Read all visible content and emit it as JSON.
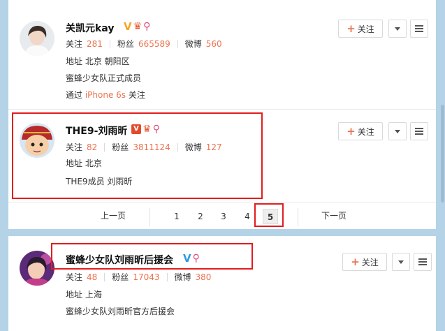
{
  "users": [
    {
      "name": "关凯元kay",
      "follow_label": "关注",
      "follow_count": "281",
      "fans_label": "粉丝",
      "fans_count": "665589",
      "weibo_label": "微博",
      "weibo_count": "560",
      "address_label": "地址",
      "address": "北京 朝阳区",
      "bio": "蜜蜂少女队正式成员",
      "via_prefix": "通过",
      "via_device": "iPhone 6s",
      "via_suffix": "关注",
      "button_label": "关注",
      "badge": "V"
    },
    {
      "name": "THE9-刘雨昕",
      "follow_label": "关注",
      "follow_count": "82",
      "fans_label": "粉丝",
      "fans_count": "3811124",
      "weibo_label": "微博",
      "weibo_count": "127",
      "address_label": "地址",
      "address": "北京",
      "bio": "THE9成员 刘雨昕",
      "button_label": "关注",
      "badge": "V"
    },
    {
      "name": "蜜蜂少女队刘雨昕后援会",
      "follow_label": "关注",
      "follow_count": "48",
      "fans_label": "粉丝",
      "fans_count": "17043",
      "weibo_label": "微博",
      "weibo_count": "380",
      "address_label": "地址",
      "address": "上海",
      "bio": "蜜蜂少女队刘雨昕官方后援会",
      "button_label": "关注",
      "badge": "V"
    }
  ],
  "pager": {
    "prev": "上一页",
    "next": "下一页",
    "pages": [
      "1",
      "2",
      "3",
      "4",
      "5"
    ],
    "current": "5"
  },
  "icons": {
    "fans_badge": "fan-club-icon",
    "search_badge": "super-topic-icon"
  },
  "colors": {
    "accent": "#eb7350",
    "highlight_box": "#e31c1c",
    "background": "#b4d3e7"
  }
}
